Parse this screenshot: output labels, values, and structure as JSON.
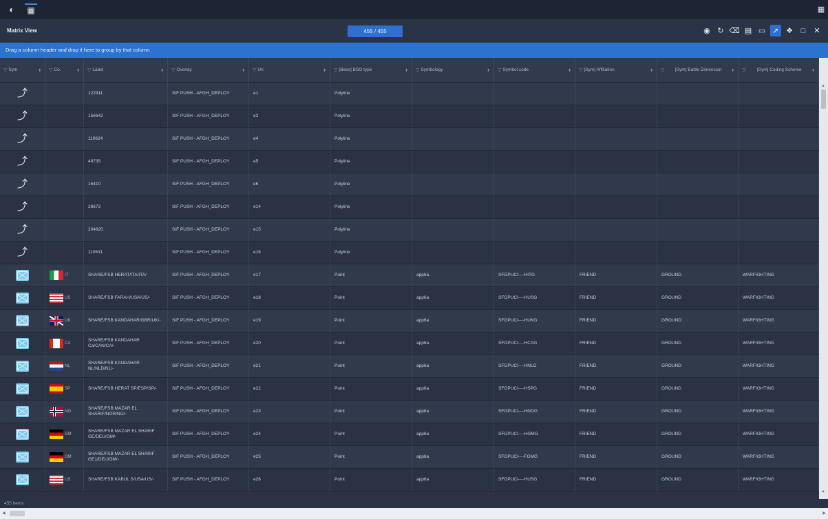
{
  "topbar": {
    "left_icons": [
      "globe-icon",
      "grid-icon"
    ],
    "right_icon": "panel-icon"
  },
  "titlebar": {
    "title": "Matrix View",
    "count": "455 / 455",
    "tools": [
      "globe-icon",
      "refresh-icon",
      "filter-clear-icon",
      "table-icon",
      "export-icon",
      "polyline-icon",
      "help-icon",
      "maximize-icon",
      "close-icon"
    ]
  },
  "groupbar": {
    "text": "Drag a column header and drop it here to group by that column"
  },
  "columns": [
    "Sym",
    "Co.",
    "Label",
    "Overlay",
    "Uri",
    "[Base] BSO type",
    "Symbology",
    "Symbol code",
    "[Sym] Affiliation",
    "[Sym] Battle Dimension",
    "[Sym] Coding Scheme"
  ],
  "rows": [
    {
      "sym": "polyline",
      "flag": "",
      "cc": "",
      "label": "122911",
      "overlay": "SIF PUSH - AFGH_DEPLOY",
      "uri": "e1",
      "bso": "Polyline",
      "symbology": "",
      "code": "",
      "aff": "",
      "dim": "",
      "scheme": ""
    },
    {
      "sym": "polyline",
      "flag": "",
      "cc": "",
      "label": "156642",
      "overlay": "SIF PUSH - AFGH_DEPLOY",
      "uri": "e3",
      "bso": "Polyline",
      "symbology": "",
      "code": "",
      "aff": "",
      "dim": "",
      "scheme": ""
    },
    {
      "sym": "polyline",
      "flag": "",
      "cc": "",
      "label": "110624",
      "overlay": "SIF PUSH - AFGH_DEPLOY",
      "uri": "e4",
      "bso": "Polyline",
      "symbology": "",
      "code": "",
      "aff": "",
      "dim": "",
      "scheme": ""
    },
    {
      "sym": "polyline",
      "flag": "",
      "cc": "",
      "label": "49735",
      "overlay": "SIF PUSH - AFGH_DEPLOY",
      "uri": "e5",
      "bso": "Polyline",
      "symbology": "",
      "code": "",
      "aff": "",
      "dim": "",
      "scheme": ""
    },
    {
      "sym": "polyline",
      "flag": "",
      "cc": "",
      "label": "16410",
      "overlay": "SIF PUSH - AFGH_DEPLOY",
      "uri": "e6",
      "bso": "Polyline",
      "symbology": "",
      "code": "",
      "aff": "",
      "dim": "",
      "scheme": ""
    },
    {
      "sym": "polyline",
      "flag": "",
      "cc": "",
      "label": "28673",
      "overlay": "SIF PUSH - AFGH_DEPLOY",
      "uri": "e14",
      "bso": "Polyline",
      "symbology": "",
      "code": "",
      "aff": "",
      "dim": "",
      "scheme": ""
    },
    {
      "sym": "polyline",
      "flag": "",
      "cc": "",
      "label": "204820",
      "overlay": "SIF PUSH - AFGH_DEPLOY",
      "uri": "e15",
      "bso": "Polyline",
      "symbology": "",
      "code": "",
      "aff": "",
      "dim": "",
      "scheme": ""
    },
    {
      "sym": "polyline",
      "flag": "",
      "cc": "",
      "label": "110631",
      "overlay": "SIF PUSH - AFGH_DEPLOY",
      "uri": "e16",
      "bso": "Polyline",
      "symbology": "",
      "code": "",
      "aff": "",
      "dim": "",
      "scheme": ""
    },
    {
      "sym": "message",
      "flag": "IT",
      "cc": "IT",
      "label": "SHARE/FSB HERAT/ITA/ITA/",
      "overlay": "SIF PUSH - AFGH_DEPLOY",
      "uri": "e17",
      "bso": "Point",
      "symbology": "app6a",
      "code": "SFGPUCI----HITG",
      "aff": "FRIEND",
      "dim": "GROUND",
      "scheme": "WARFIGHTING"
    },
    {
      "sym": "message",
      "flag": "US",
      "cc": "US",
      "label": "SHARE/FSB FARAH/USA/US/-",
      "overlay": "SIF PUSH - AFGH_DEPLOY",
      "uri": "e18",
      "bso": "Point",
      "symbology": "app6a",
      "code": "SFGPUCI----HUSG",
      "aff": "FRIEND",
      "dim": "GROUND",
      "scheme": "WARFIGHTING"
    },
    {
      "sym": "message",
      "flag": "UK",
      "cc": "UK",
      "label": "SHARE/FSB KANDAHAR/GBR/UK/-",
      "overlay": "SIF PUSH - AFGH_DEPLOY",
      "uri": "e19",
      "bso": "Point",
      "symbology": "app6a",
      "code": "SFGPUCI----HUKG",
      "aff": "FRIEND",
      "dim": "GROUND",
      "scheme": "WARFIGHTING"
    },
    {
      "sym": "message",
      "flag": "CA",
      "cc": "CA",
      "label": "SHARE/FSB KANDAHAR Ca/CAN/CA/-",
      "overlay": "SIF PUSH - AFGH_DEPLOY",
      "uri": "e20",
      "bso": "Point",
      "symbology": "app6a",
      "code": "SFGPUCI----HCAG",
      "aff": "FRIEND",
      "dim": "GROUND",
      "scheme": "WARFIGHTING"
    },
    {
      "sym": "message",
      "flag": "NL",
      "cc": "NL",
      "label": "SHARE/FSB KANDAHAR NL/NLD/NL/-",
      "overlay": "SIF PUSH - AFGH_DEPLOY",
      "uri": "e21",
      "bso": "Point",
      "symbology": "app6a",
      "code": "SFGPUCI----HNLG",
      "aff": "FRIEND",
      "dim": "GROUND",
      "scheme": "WARFIGHTING"
    },
    {
      "sym": "message",
      "flag": "SP",
      "cc": "SP",
      "label": "SHARE/FSB HERAT SP/ESP/SP/-",
      "overlay": "SIF PUSH - AFGH_DEPLOY",
      "uri": "e22",
      "bso": "Point",
      "symbology": "app6a",
      "code": "SFGPUCI----HSPG",
      "aff": "FRIEND",
      "dim": "GROUND",
      "scheme": "WARFIGHTING"
    },
    {
      "sym": "message",
      "flag": "NO",
      "cc": "NO",
      "label": "SHARE/FSB MAZAR EL SHARIF/NOR/NO/-",
      "overlay": "SIF PUSH - AFGH_DEPLOY",
      "uri": "e23",
      "bso": "Point",
      "symbology": "app6a",
      "code": "SFGPUCI----HNOG",
      "aff": "FRIEND",
      "dim": "GROUND",
      "scheme": "WARFIGHTING"
    },
    {
      "sym": "message",
      "flag": "GM",
      "cc": "GM",
      "label": "SHARE/FSB MAZAR EL SHARIF GE/DEU/GM/-",
      "overlay": "SIF PUSH - AFGH_DEPLOY",
      "uri": "e24",
      "bso": "Point",
      "symbology": "app6a",
      "code": "SFGPUCI----HGMG",
      "aff": "FRIEND",
      "dim": "GROUND",
      "scheme": "WARFIGHTING"
    },
    {
      "sym": "message",
      "flag": "GM",
      "cc": "GM",
      "label": "SHARE/FSB MAZAR EL SHARIF GE1/DEU/GM/-",
      "overlay": "SIF PUSH - AFGH_DEPLOY",
      "uri": "e25",
      "bso": "Point",
      "symbology": "app6a",
      "code": "SFGPUCI----FGMG",
      "aff": "FRIEND",
      "dim": "GROUND",
      "scheme": "WARFIGHTING"
    },
    {
      "sym": "message",
      "flag": "US",
      "cc": "US",
      "label": "SHARE/FSB KABUL S/USA/US/-",
      "overlay": "SIF PUSH - AFGH_DEPLOY",
      "uri": "e26",
      "bso": "Point",
      "symbology": "app6a",
      "code": "SFGPUCI----HUSG",
      "aff": "FRIEND",
      "dim": "GROUND",
      "scheme": "WARFIGHTING"
    }
  ],
  "footer": {
    "text": "455 Items"
  },
  "colors": {
    "accent": "#2f6fd0",
    "header_bg": "#1d2433",
    "grid_bg": "#2a3243",
    "group_bar": "#2b73d1"
  }
}
